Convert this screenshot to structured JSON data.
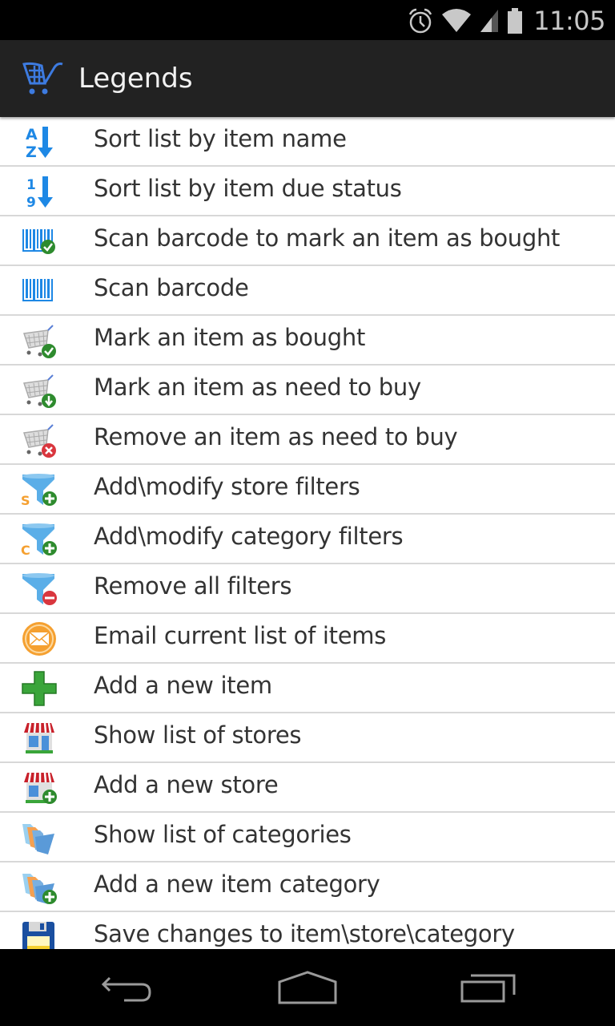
{
  "status_bar": {
    "time": "11:05",
    "icons": [
      "alarm-icon",
      "wifi-icon",
      "signal-icon",
      "battery-icon"
    ]
  },
  "action_bar": {
    "app_icon": "shopping-cart-icon",
    "title": "Legends"
  },
  "legend_items": [
    {
      "icon": "sort-az-icon",
      "label": "Sort list by item name"
    },
    {
      "icon": "sort-19-icon",
      "label": "Sort list by item due status"
    },
    {
      "icon": "barcode-check-icon",
      "label": "Scan barcode to mark an item as bought"
    },
    {
      "icon": "barcode-icon",
      "label": "Scan barcode"
    },
    {
      "icon": "cart-check-icon",
      "label": "Mark an item as bought"
    },
    {
      "icon": "cart-download-icon",
      "label": "Mark an item as need to buy"
    },
    {
      "icon": "cart-remove-icon",
      "label": "Remove an item as need to buy"
    },
    {
      "icon": "filter-store-add-icon",
      "label": "Add\\modify store filters"
    },
    {
      "icon": "filter-category-add-icon",
      "label": "Add\\modify category filters"
    },
    {
      "icon": "filter-remove-icon",
      "label": "Remove all filters"
    },
    {
      "icon": "email-icon",
      "label": "Email current list of items"
    },
    {
      "icon": "add-icon",
      "label": "Add a new item"
    },
    {
      "icon": "store-icon",
      "label": "Show list of stores"
    },
    {
      "icon": "store-add-icon",
      "label": "Add a new store"
    },
    {
      "icon": "folders-icon",
      "label": "Show list of categories"
    },
    {
      "icon": "folders-add-icon",
      "label": "Add a new item category"
    },
    {
      "icon": "save-icon",
      "label": "Save changes to item\\store\\category"
    }
  ],
  "nav_bar": {
    "buttons": [
      "back-icon",
      "home-icon",
      "recents-icon"
    ]
  },
  "colors": {
    "icon_blue": "#1e88e5",
    "green": "#2e8b2e",
    "red": "#d9363e",
    "orange": "#f5a030",
    "action_bar": "#222222"
  }
}
